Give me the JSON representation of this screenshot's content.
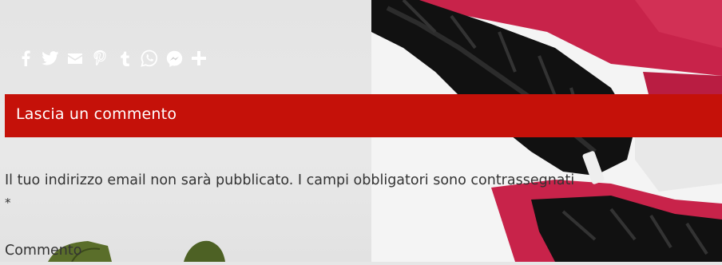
{
  "share": {
    "buttons": [
      {
        "icon": "facebook-icon"
      },
      {
        "icon": "twitter-icon"
      },
      {
        "icon": "email-icon"
      },
      {
        "icon": "pinterest-icon"
      },
      {
        "icon": "tumblr-icon"
      },
      {
        "icon": "whatsapp-icon"
      },
      {
        "icon": "messenger-icon"
      },
      {
        "icon": "plus-icon"
      }
    ]
  },
  "comments": {
    "heading": "Lascia un commento",
    "notice": "Il tuo indirizzo email non sarà pubblicato. I campi obbligatori sono contrassegnati",
    "required_mark": "*",
    "comment_label": "Commento"
  },
  "colors": {
    "accent": "#c51109",
    "share_icon": "#ffffff",
    "text": "#333333"
  }
}
